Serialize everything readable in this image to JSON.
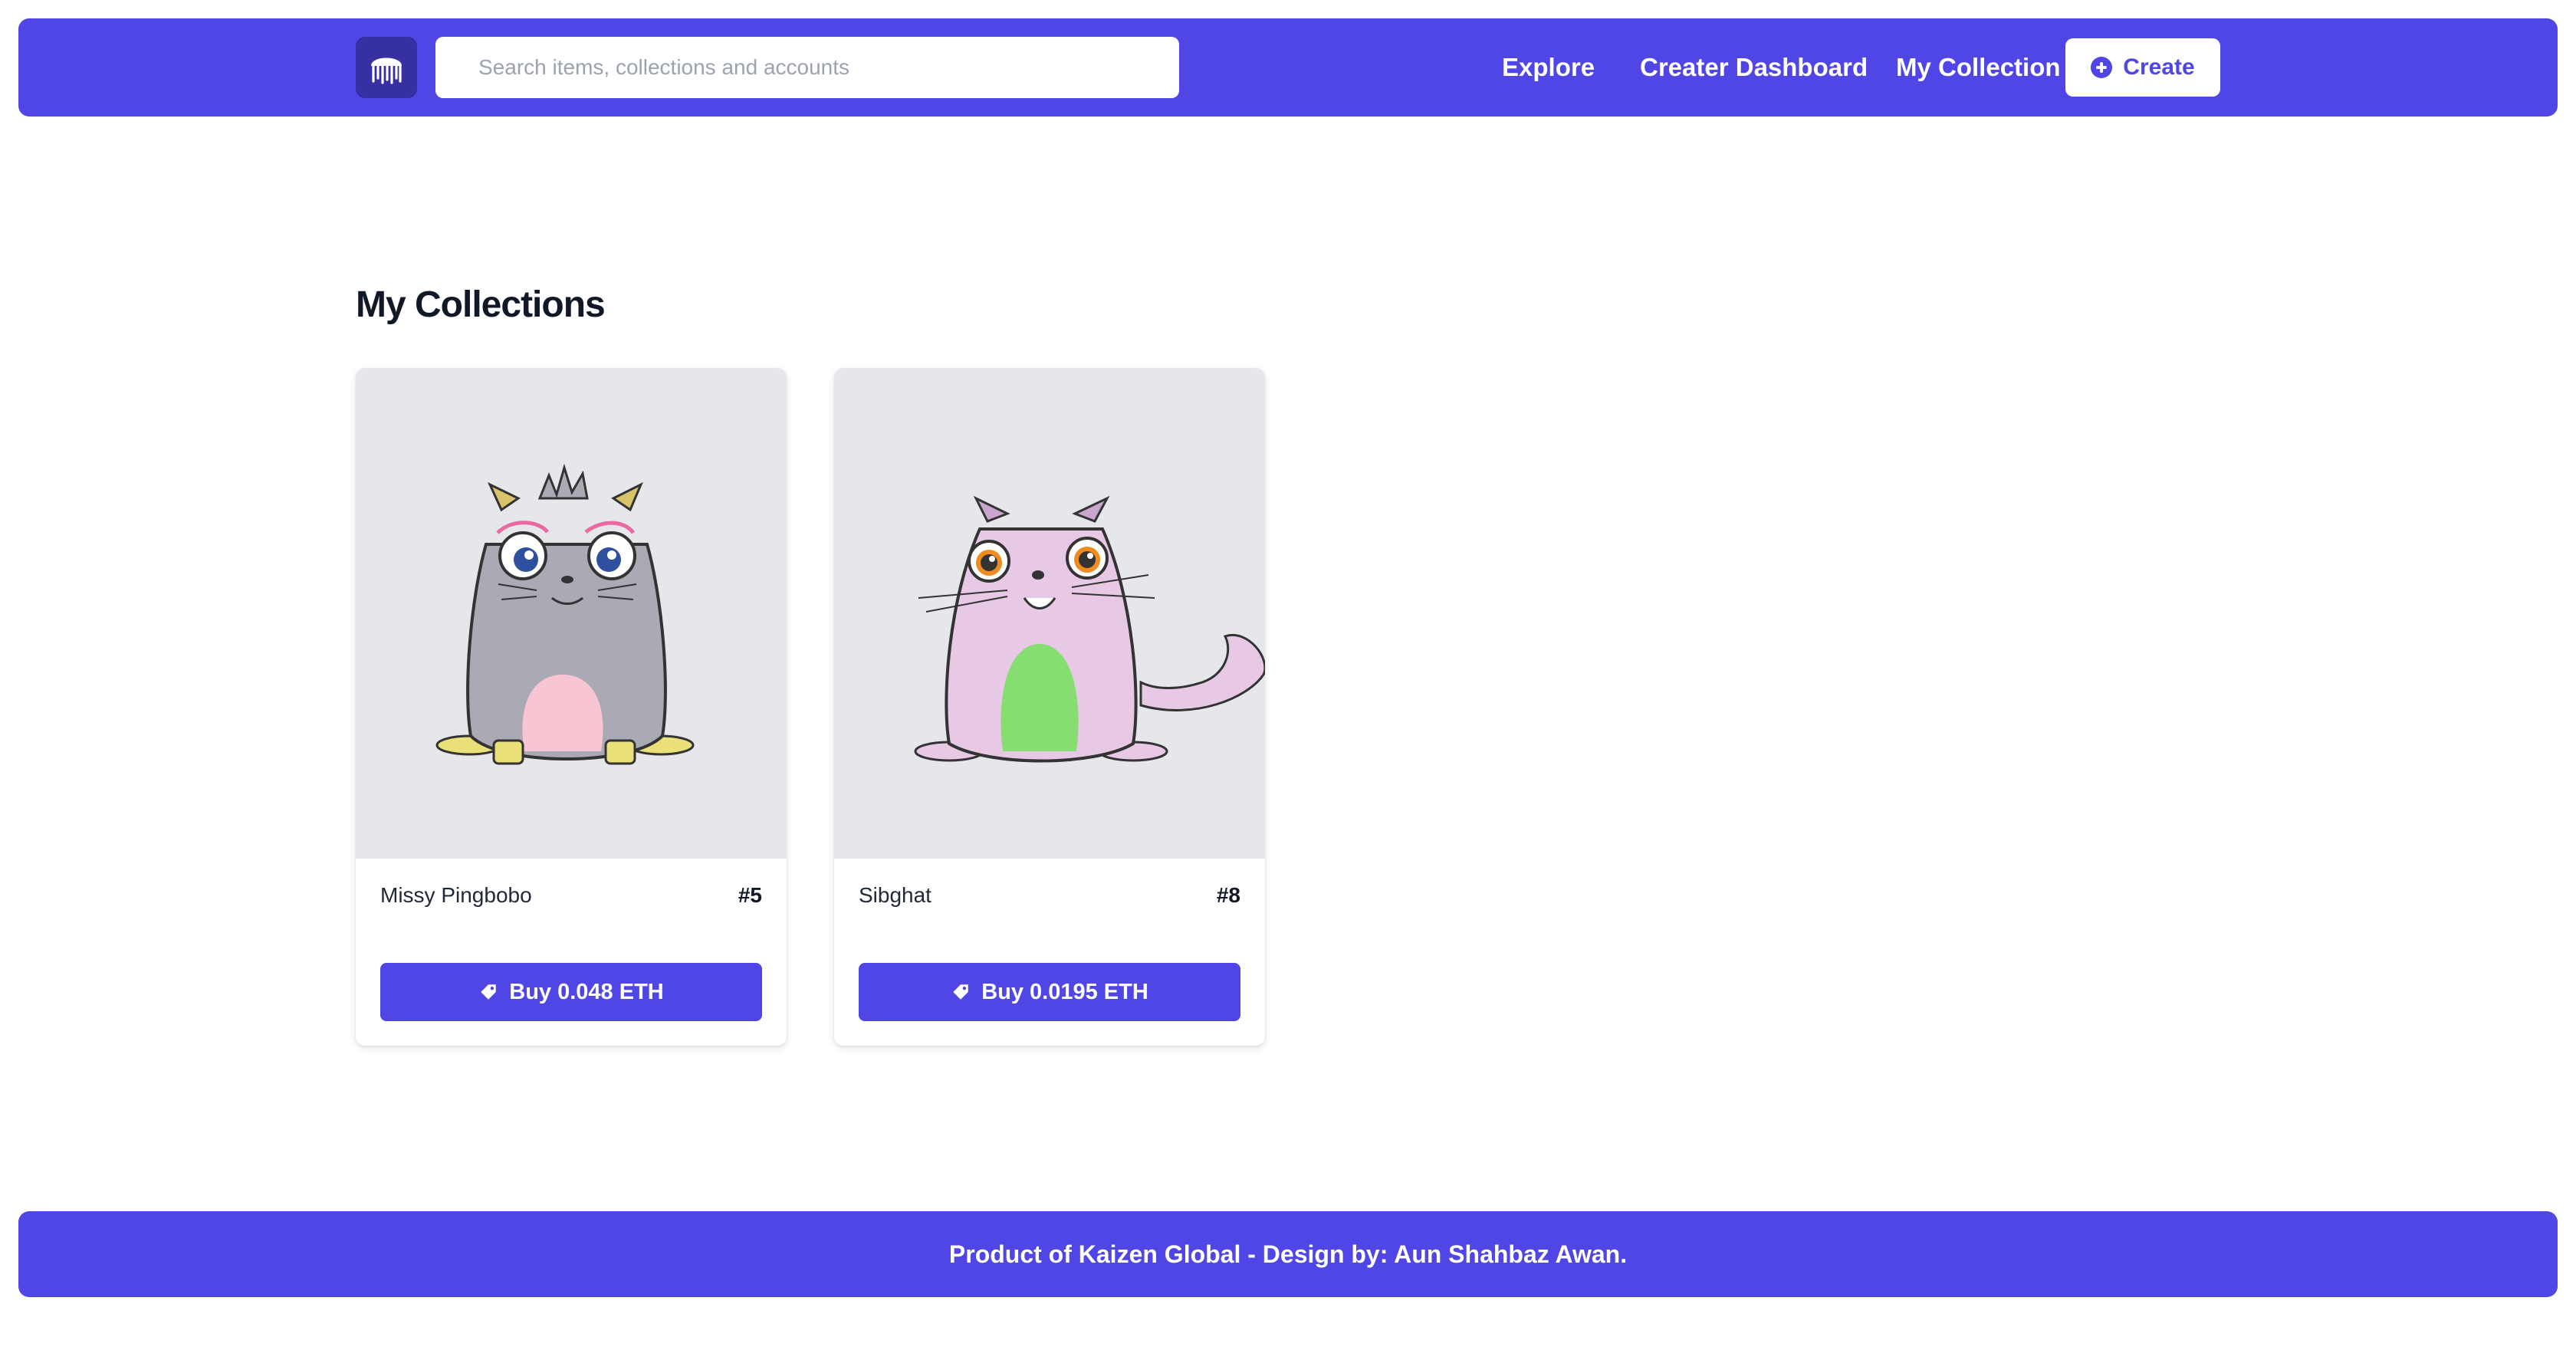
{
  "header": {
    "search_placeholder": "Search items, collections and accounts",
    "nav": {
      "explore": "Explore",
      "creator_dashboard": "Creater Dashboard",
      "my_collection": "My Collection"
    },
    "create_label": "Create",
    "icons": {
      "logo": "jellyfish-logo-icon",
      "create": "plus-circle-icon"
    }
  },
  "main": {
    "title": "My Collections",
    "cards": [
      {
        "name": "Missy Pingbobo",
        "id": "#5",
        "buy_label": "Buy 0.048 ETH",
        "image": "grey-cat"
      },
      {
        "name": "Sibghat",
        "id": "#8",
        "buy_label": "Buy 0.0195 ETH",
        "image": "pink-cat"
      }
    ]
  },
  "footer": {
    "text": "Product of Kaizen Global - Design by: Aun Shahbaz Awan."
  },
  "colors": {
    "primary": "#4f46e5",
    "primary_dark": "#3730a3",
    "card_image_bg": "#e5e7eb",
    "text_dark": "#111827"
  }
}
